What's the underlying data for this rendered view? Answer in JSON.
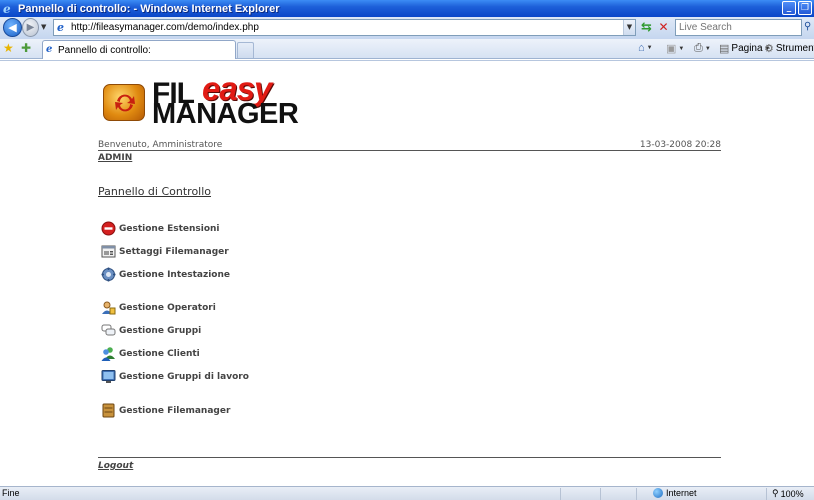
{
  "window": {
    "title": "Pannello di controllo: - Windows Internet Explorer",
    "minimize": "_",
    "restore": "❐"
  },
  "browser": {
    "url": "http://fileasymanager.com/demo/index.php",
    "search_placeholder": "Live Search",
    "tab_label": "Pannello di controllo:",
    "page_menu": "Pagina",
    "tools_menu": "Strumenti",
    "status_text": "Fine",
    "zone": "Internet",
    "zoom": "100%"
  },
  "logo": {
    "part1": "FIL",
    "part2": "easy",
    "part3": "MANAGER"
  },
  "header": {
    "welcome": "Benvenuto, Amministratore",
    "datetime": "13-03-2008 20:28",
    "username": "ADMIN"
  },
  "panel": {
    "title": "Pannello di Controllo"
  },
  "menu": {
    "items": [
      {
        "label": "Gestione Estensioni",
        "icon": "no-entry-icon"
      },
      {
        "label": "Settaggi Filemanager",
        "icon": "settings-window-icon"
      },
      {
        "label": "Gestione Intestazione",
        "icon": "gear-icon"
      },
      {
        "label": "Gestione Operatori",
        "icon": "operators-icon"
      },
      {
        "label": "Gestione Gruppi",
        "icon": "chat-bubbles-icon"
      },
      {
        "label": "Gestione Clienti",
        "icon": "users-icon"
      },
      {
        "label": "Gestione Gruppi di lavoro",
        "icon": "monitor-icon"
      },
      {
        "label": "Gestione Filemanager",
        "icon": "archive-icon"
      }
    ]
  },
  "footer": {
    "logout": "Logout"
  }
}
